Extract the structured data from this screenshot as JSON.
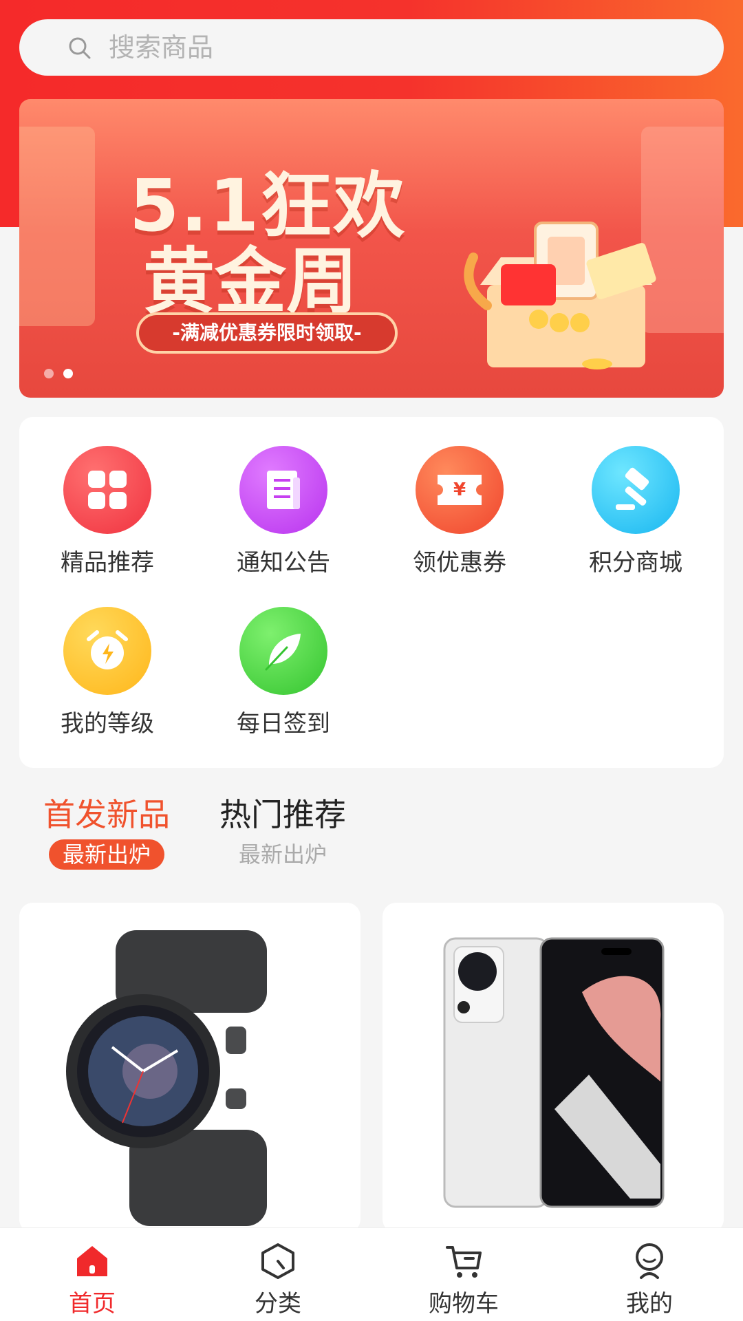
{
  "search": {
    "placeholder": "搜索商品"
  },
  "banner": {
    "line1": "5.1狂欢",
    "line2": "黄金周",
    "ribbon": "-满减优惠券限时领取-",
    "dots": 2,
    "active_dot": 2
  },
  "menu": {
    "items": [
      {
        "label": "精品推荐",
        "icon": "grid-icon",
        "color": "#f53a4a"
      },
      {
        "label": "通知公告",
        "icon": "document-icon",
        "color": "#c640f0"
      },
      {
        "label": "领优惠券",
        "icon": "coupon-icon",
        "color": "#f5583a"
      },
      {
        "label": "积分商城",
        "icon": "gavel-icon",
        "color": "#2cc6f5"
      },
      {
        "label": "我的等级",
        "icon": "alarm-icon",
        "color": "#ffc22a"
      },
      {
        "label": "每日签到",
        "icon": "feather-icon",
        "color": "#4dd24a"
      }
    ]
  },
  "tabs": [
    {
      "title": "首发新品",
      "sub": "最新出炉",
      "active": true
    },
    {
      "title": "热门推荐",
      "sub": "最新出炉",
      "active": false
    }
  ],
  "products": [
    {
      "name": "smartwatch-image"
    },
    {
      "name": "phone-image"
    }
  ],
  "tabbar": {
    "items": [
      {
        "label": "首页",
        "icon": "home-icon",
        "active": true
      },
      {
        "label": "分类",
        "icon": "category-icon",
        "active": false
      },
      {
        "label": "购物车",
        "icon": "cart-icon",
        "active": false
      },
      {
        "label": "我的",
        "icon": "profile-icon",
        "active": false
      }
    ]
  },
  "colors": {
    "accent": "#f0522d",
    "hero_red": "#f5322c",
    "tabbar_active": "#f0292b"
  }
}
